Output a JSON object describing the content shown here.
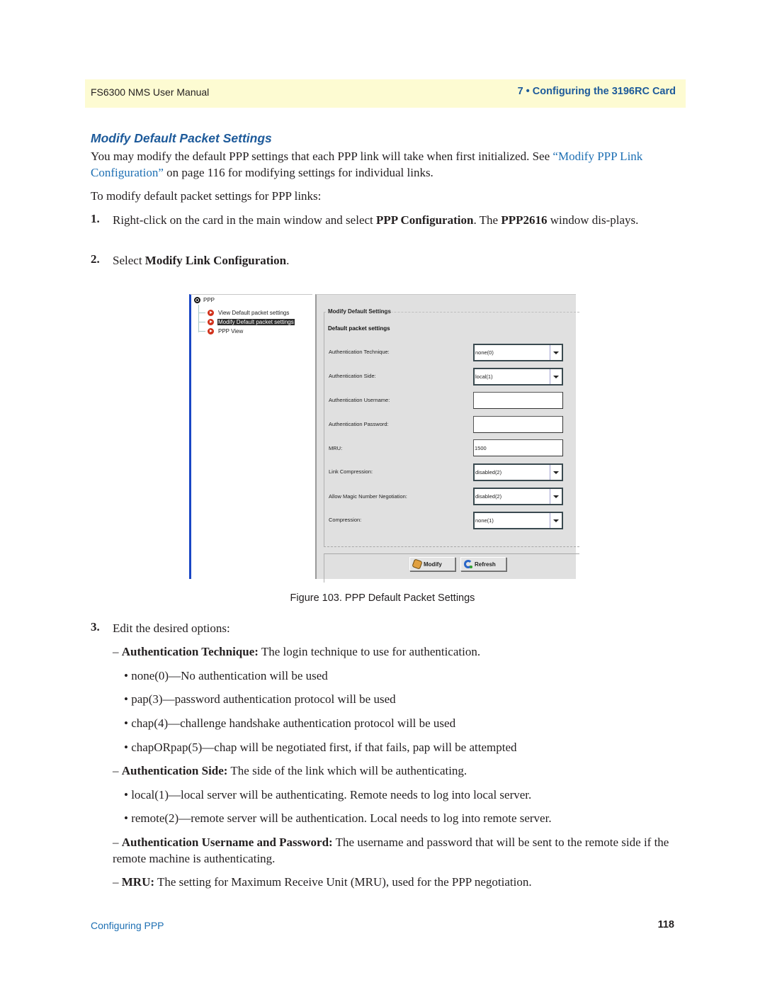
{
  "header": {
    "manual_title": "FS6300 NMS User Manual",
    "chapter": "7 • Configuring the 3196RC Card"
  },
  "section": {
    "title": "Modify Default Packet Settings",
    "intro_part1": "You may modify the default PPP settings that each PPP link will take when first initialized. See ",
    "intro_link": "“Modify PPP Link Configuration”",
    "intro_part2": " on page 116 for modifying settings for individual links.",
    "lead": "To modify default packet settings for PPP links:"
  },
  "steps": [
    {
      "number": "1.",
      "text_a": "Right-click on the card in the main window and select ",
      "bold_a": "PPP Configuration",
      "text_b": ". The ",
      "bold_b": "PPP2616",
      "text_c": " window dis-plays."
    },
    {
      "number": "2.",
      "text_a": "Select ",
      "bold_a": "Modify Link Configuration",
      "text_b": "."
    },
    {
      "number": "3.",
      "text_a": "Edit the desired options:"
    }
  ],
  "figure": {
    "caption": "Figure 103. PPP Default Packet Settings",
    "tree": {
      "root": "PPP",
      "items": [
        {
          "label": "View Default packet settings",
          "selected": false
        },
        {
          "label": "Modify Default packet settings",
          "selected": true
        },
        {
          "label": "PPP View",
          "selected": false
        }
      ]
    },
    "panel": {
      "group_title": "Modify Default Settings",
      "subtitle": "Default packet settings",
      "fields": [
        {
          "label": "Authentication Technique:",
          "type": "select",
          "value": "none(0)"
        },
        {
          "label": "Authentication Side:",
          "type": "select",
          "value": "local(1)"
        },
        {
          "label": "Authentication Username:",
          "type": "text",
          "value": ""
        },
        {
          "label": "Authentication Password:",
          "type": "text",
          "value": ""
        },
        {
          "label": "MRU:",
          "type": "text",
          "value": "1500"
        },
        {
          "label": "Link Compression:",
          "type": "select",
          "value": "disabled(2)"
        },
        {
          "label": "Allow Magic Number Negotiation:",
          "type": "select",
          "value": "disabled(2)"
        },
        {
          "label": "Compression:",
          "type": "select",
          "value": "none(1)"
        }
      ],
      "buttons": {
        "modify": "Modify",
        "refresh": "Refresh"
      }
    }
  },
  "options": [
    {
      "dash": "–",
      "term": "Authentication Technique:",
      "desc": " The login technique to use for authentication.",
      "bullets": [
        "• none(0)—No authentication will be used",
        "• pap(3)—password authentication protocol will be used",
        "• chap(4)—challenge handshake authentication protocol will be used",
        "• chapORpap(5)—chap will be negotiated first, if that fails, pap will be attempted"
      ]
    },
    {
      "dash": "–",
      "term": "Authentication Side:",
      "desc": " The side of the link which will be authenticating.",
      "bullets": [
        "• local(1)—local server will be authenticating. Remote needs to log into local server.",
        "• remote(2)—remote server will be authentication. Local needs to log into remote server."
      ]
    },
    {
      "dash": "–",
      "term": "Authentication Username and Password:",
      "desc": " The username and password that will be sent to the remote side if the remote machine is authenticating.",
      "bullets": []
    },
    {
      "dash": "–",
      "term": "MRU:",
      "desc": " The setting for Maximum Receive Unit (MRU), used for the PPP negotiation.",
      "bullets": []
    }
  ],
  "footer": {
    "section_name": "Configuring PPP",
    "page_number": "118"
  },
  "colors": {
    "accent_blue": "#1d5a9a",
    "link_blue": "#1d6fb3",
    "header_bg": "#fdfbd2",
    "panel_bg": "#e0e0e0"
  }
}
